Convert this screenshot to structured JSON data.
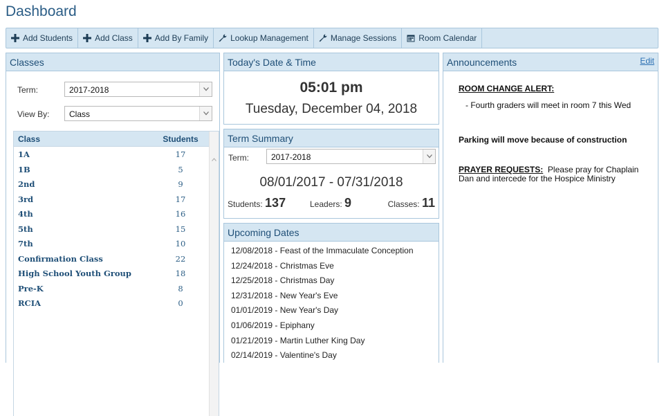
{
  "page_title": "Dashboard",
  "toolbar": [
    {
      "label": "Add Students",
      "icon": "plus-icon"
    },
    {
      "label": "Add Class",
      "icon": "plus-icon"
    },
    {
      "label": "Add By Family",
      "icon": "plus-icon"
    },
    {
      "label": "Lookup Management",
      "icon": "wrench-icon"
    },
    {
      "label": "Manage Sessions",
      "icon": "wrench-icon"
    },
    {
      "label": "Room Calendar",
      "icon": "calendar-icon"
    }
  ],
  "classes": {
    "title": "Classes",
    "term_label": "Term:",
    "term_value": "2017-2018",
    "viewby_label": "View By:",
    "viewby_value": "Class",
    "col_class": "Class",
    "col_students": "Students",
    "rows": [
      {
        "name": "1A",
        "students": "17"
      },
      {
        "name": "1B",
        "students": "5"
      },
      {
        "name": "2nd",
        "students": "9"
      },
      {
        "name": "3rd",
        "students": "17"
      },
      {
        "name": "4th",
        "students": "16"
      },
      {
        "name": "5th",
        "students": "15"
      },
      {
        "name": "7th",
        "students": "10"
      },
      {
        "name": "Confirmation Class",
        "students": "22"
      },
      {
        "name": "High School Youth Group",
        "students": "18"
      },
      {
        "name": "Pre-K",
        "students": "8"
      },
      {
        "name": "RCIA",
        "students": "0"
      }
    ]
  },
  "today": {
    "title": "Today's Date & Time",
    "time": "05:01 pm",
    "date": "Tuesday, December 04, 2018"
  },
  "term_summary": {
    "title": "Term Summary",
    "term_label": "Term:",
    "term_value": "2017-2018",
    "range": "08/01/2017 - 07/31/2018",
    "students_label": "Students:",
    "students_value": "137",
    "leaders_label": "Leaders:",
    "leaders_value": "9",
    "classes_label": "Classes:",
    "classes_value": "11"
  },
  "upcoming": {
    "title": "Upcoming Dates",
    "items": [
      "12/08/2018 - Feast of the Immaculate Conception",
      "12/24/2018 - Christmas Eve",
      "12/25/2018 - Christmas Day",
      "12/31/2018 - New Year's Eve",
      "01/01/2019 - New Year's Day",
      "01/06/2019 - Epiphany",
      "01/21/2019 - Martin Luther King Day",
      "02/14/2019 - Valentine's Day"
    ]
  },
  "announcements": {
    "title": "Announcements",
    "edit_label": "Edit",
    "alert_title": "ROOM CHANGE ALERT:",
    "alert_text": "- Fourth graders will meet in room 7 this Wed",
    "parking": "Parking will move because of construction",
    "prayer_title": "PRAYER REQUESTS:",
    "prayer_text": "Please pray for Chaplain Dan and intercede for the Hospice Ministry"
  }
}
